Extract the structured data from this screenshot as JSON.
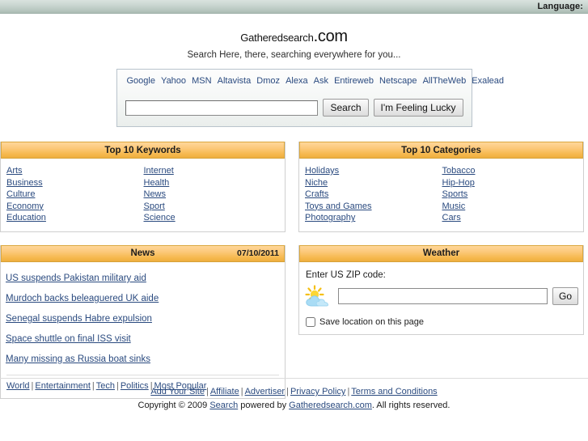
{
  "topbar": {
    "language_label": "Language:",
    "language_selected": ""
  },
  "header": {
    "logo_name": "Gatheredsearch",
    "logo_tld": ".com",
    "tagline": "Search Here, there, searching everywhere for you..."
  },
  "search": {
    "engines": [
      "Google",
      "Yahoo",
      "MSN",
      "Altavista",
      "Dmoz",
      "Alexa",
      "Ask",
      "Entireweb",
      "Netscape",
      "AllTheWeb",
      "Exalead"
    ],
    "query_value": "",
    "query_placeholder": "",
    "search_button": "Search",
    "lucky_button": "I'm Feeling Lucky"
  },
  "keywords_panel": {
    "title": "Top 10 Keywords",
    "left": [
      "Arts",
      "Business",
      "Culture",
      "Economy",
      "Education"
    ],
    "right": [
      "Internet",
      "Health",
      "News",
      "Sport",
      "Science"
    ]
  },
  "categories_panel": {
    "title": "Top 10 Categories",
    "left": [
      "Holidays",
      "Niche",
      "Crafts",
      "Toys and Games",
      "Photography"
    ],
    "right": [
      "Tobacco",
      "Hip-Hop",
      "Sports",
      "Music",
      "Cars"
    ]
  },
  "news_panel": {
    "title": "News",
    "date": "07/10/2011",
    "items": [
      "US suspends Pakistan military aid",
      "Murdoch backs beleaguered UK aide",
      "Senegal suspends Habre expulsion",
      "Space shuttle on final ISS visit",
      "Many missing as Russia boat sinks"
    ],
    "categories": [
      "World",
      "Entertainment",
      "Tech",
      "Politics",
      "Most Popular"
    ],
    "separator": "|"
  },
  "weather_panel": {
    "title": "Weather",
    "prompt": "Enter US ZIP code:",
    "zip_value": "",
    "zip_placeholder": "",
    "go_button": "Go",
    "save_label": "Save location on this page",
    "save_checked": false,
    "icon": "sun-behind-cloud-icon"
  },
  "footer": {
    "links": [
      "Add Your Site",
      "Affiliate",
      "Advertiser",
      "Privacy Policy",
      "Terms and Conditions"
    ],
    "separator": "|",
    "copyright_prefix": "Copyright © 2009 ",
    "copyright_link1": "Search",
    "copyright_middle": " powered by ",
    "copyright_link2": "Gatheredsearch.com",
    "copyright_suffix": ". All rights reserved."
  },
  "colors": {
    "panel_header_orange": "#f6b94f",
    "link_blue": "#2a4a7f",
    "topbar_green": "#ccd8d3"
  }
}
